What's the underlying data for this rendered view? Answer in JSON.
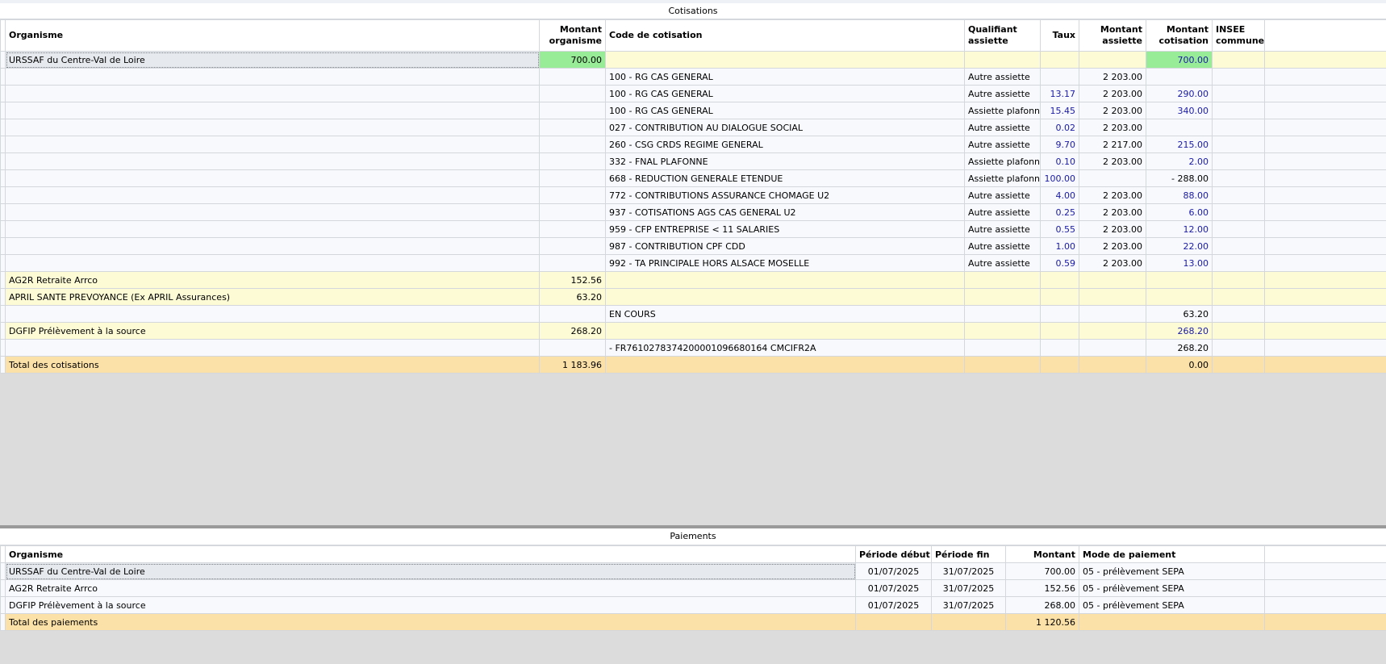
{
  "cotisations": {
    "title": "Cotisations",
    "columns": {
      "organisme": "Organisme",
      "montant_organisme": "Montant organisme",
      "code": "Code de cotisation",
      "qualifiant": "Qualifiant assiette",
      "taux": "Taux",
      "montant_assiette": "Montant assiette",
      "montant_cotisation": "Montant cotisation",
      "insee": "INSEE commune"
    },
    "rows": [
      {
        "kind": "org",
        "organisme": "URSSAF du Centre-Val de Loire",
        "montant_organisme": "700.00",
        "code": "",
        "qualifiant": "",
        "taux": "",
        "assiette": "",
        "cotisation": "700.00",
        "insee": "",
        "selected": true,
        "green": true
      },
      {
        "kind": "plain",
        "organisme": "",
        "montant_organisme": "",
        "code": "100 - RG CAS GENERAL",
        "qualifiant": "Autre assiette",
        "taux": "",
        "assiette": "2 203.00",
        "cotisation": "",
        "insee": ""
      },
      {
        "kind": "plain",
        "organisme": "",
        "montant_organisme": "",
        "code": "100 - RG CAS GENERAL",
        "qualifiant": "Autre assiette",
        "taux": "13.17",
        "assiette": "2 203.00",
        "cotisation": "290.00",
        "insee": ""
      },
      {
        "kind": "plain",
        "organisme": "",
        "montant_organisme": "",
        "code": "100 - RG CAS GENERAL",
        "qualifiant": "Assiette plafonnée",
        "taux": "15.45",
        "assiette": "2 203.00",
        "cotisation": "340.00",
        "insee": ""
      },
      {
        "kind": "plain",
        "organisme": "",
        "montant_organisme": "",
        "code": "027 - CONTRIBUTION AU DIALOGUE SOCIAL",
        "qualifiant": "Autre assiette",
        "taux": "0.02",
        "assiette": "2 203.00",
        "cotisation": "",
        "insee": ""
      },
      {
        "kind": "plain",
        "organisme": "",
        "montant_organisme": "",
        "code": "260 - CSG CRDS REGIME GENERAL",
        "qualifiant": "Autre assiette",
        "taux": "9.70",
        "assiette": "2 217.00",
        "cotisation": "215.00",
        "insee": ""
      },
      {
        "kind": "plain",
        "organisme": "",
        "montant_organisme": "",
        "code": "332 - FNAL PLAFONNE",
        "qualifiant": "Assiette plafonnée",
        "taux": "0.10",
        "assiette": "2 203.00",
        "cotisation": "2.00",
        "insee": ""
      },
      {
        "kind": "plain",
        "organisme": "",
        "montant_organisme": "",
        "code": "668 - REDUCTION GENERALE ETENDUE",
        "qualifiant": "Assiette plafonnée",
        "taux": "100.00",
        "assiette": "",
        "cotisation": "- 288.00",
        "insee": "",
        "black_cot": true
      },
      {
        "kind": "plain",
        "organisme": "",
        "montant_organisme": "",
        "code": "772 - CONTRIBUTIONS ASSURANCE CHOMAGE U2",
        "qualifiant": "Autre assiette",
        "taux": "4.00",
        "assiette": "2 203.00",
        "cotisation": "88.00",
        "insee": ""
      },
      {
        "kind": "plain",
        "organisme": "",
        "montant_organisme": "",
        "code": "937 - COTISATIONS AGS CAS GENERAL U2",
        "qualifiant": "Autre assiette",
        "taux": "0.25",
        "assiette": "2 203.00",
        "cotisation": "6.00",
        "insee": ""
      },
      {
        "kind": "plain",
        "organisme": "",
        "montant_organisme": "",
        "code": "959 - CFP ENTREPRISE < 11 SALARIES",
        "qualifiant": "Autre assiette",
        "taux": "0.55",
        "assiette": "2 203.00",
        "cotisation": "12.00",
        "insee": ""
      },
      {
        "kind": "plain",
        "organisme": "",
        "montant_organisme": "",
        "code": "987 - CONTRIBUTION CPF CDD",
        "qualifiant": "Autre assiette",
        "taux": "1.00",
        "assiette": "2 203.00",
        "cotisation": "22.00",
        "insee": ""
      },
      {
        "kind": "plain",
        "organisme": "",
        "montant_organisme": "",
        "code": "992 - TA PRINCIPALE HORS ALSACE MOSELLE",
        "qualifiant": "Autre assiette",
        "taux": "0.59",
        "assiette": "2 203.00",
        "cotisation": "13.00",
        "insee": ""
      },
      {
        "kind": "org",
        "organisme": "AG2R Retraite Arrco",
        "montant_organisme": "152.56",
        "code": "",
        "qualifiant": "",
        "taux": "",
        "assiette": "",
        "cotisation": "",
        "insee": ""
      },
      {
        "kind": "org",
        "organisme": "APRIL SANTE PREVOYANCE (Ex APRIL Assurances)",
        "montant_organisme": "63.20",
        "code": "",
        "qualifiant": "",
        "taux": "",
        "assiette": "",
        "cotisation": "",
        "insee": ""
      },
      {
        "kind": "plain",
        "organisme": "",
        "montant_organisme": "",
        "code": "EN COURS",
        "qualifiant": "",
        "taux": "",
        "assiette": "",
        "cotisation": "63.20",
        "insee": "",
        "black_cot": true
      },
      {
        "kind": "org",
        "organisme": "DGFIP Prélèvement à la source",
        "montant_organisme": "268.20",
        "code": "",
        "qualifiant": "",
        "taux": "",
        "assiette": "",
        "cotisation": "268.20",
        "insee": ""
      },
      {
        "kind": "plain",
        "organisme": "",
        "montant_organisme": "",
        "code": " - FR7610278374200001096680164 CMCIFR2A",
        "qualifiant": "",
        "taux": "",
        "assiette": "",
        "cotisation": "268.20",
        "insee": "",
        "black_cot": true
      },
      {
        "kind": "total",
        "organisme": "Total des cotisations",
        "montant_organisme": "1 183.96",
        "code": "",
        "qualifiant": "",
        "taux": "",
        "assiette": "",
        "cotisation": "0.00",
        "insee": "",
        "black_cot": true
      }
    ]
  },
  "paiements": {
    "title": "Paiements",
    "columns": {
      "organisme": "Organisme",
      "debut": "Période début",
      "fin": "Période fin",
      "montant": "Montant",
      "mode": "Mode de paiement"
    },
    "rows": [
      {
        "kind": "plain",
        "organisme": "URSSAF du Centre-Val de Loire",
        "debut": "01/07/2025",
        "fin": "31/07/2025",
        "montant": "700.00",
        "mode": "05 - prélèvement SEPA",
        "selected": true
      },
      {
        "kind": "plain",
        "organisme": "AG2R Retraite Arrco",
        "debut": "01/07/2025",
        "fin": "31/07/2025",
        "montant": "152.56",
        "mode": "05 - prélèvement SEPA"
      },
      {
        "kind": "plain",
        "organisme": "DGFIP Prélèvement à la source",
        "debut": "01/07/2025",
        "fin": "31/07/2025",
        "montant": "268.00",
        "mode": "05 - prélèvement SEPA"
      },
      {
        "kind": "total",
        "organisme": "Total des paiements",
        "debut": "",
        "fin": "",
        "montant": "1 120.56",
        "mode": ""
      }
    ]
  },
  "colors": {
    "org_row": "#fdfbd6",
    "total_row": "#fbe0a8",
    "highlight_green": "#98ec98",
    "value_blue": "#1a1aa6"
  }
}
